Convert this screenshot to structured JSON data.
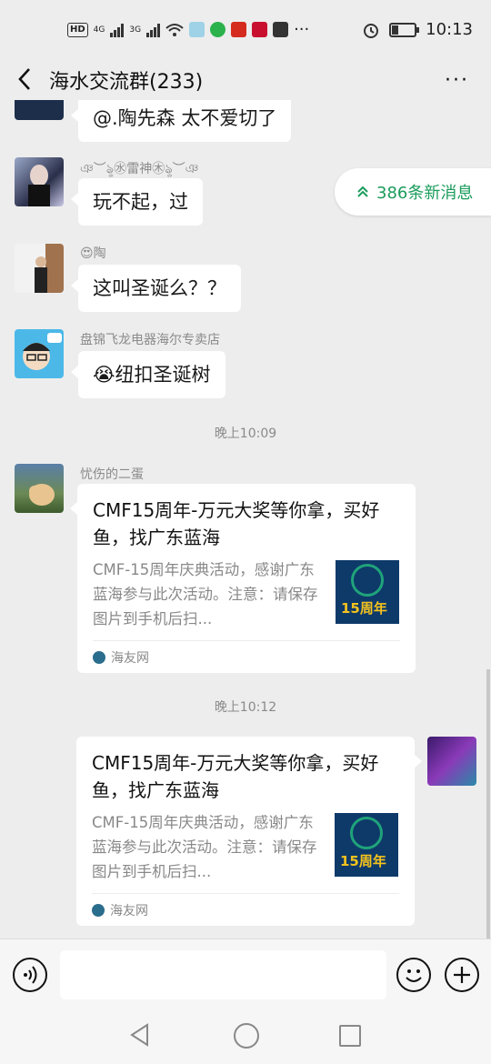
{
  "status_bar": {
    "time": "10:13",
    "net_hd": "HD",
    "net_1": "4G",
    "net_2": "3G",
    "more": "···"
  },
  "header": {
    "title": "海水交流群(233)",
    "more_label": "···"
  },
  "new_messages": {
    "label": "386条新消息"
  },
  "messages": [
    {
      "text": "@.陶先森  太不爱切了"
    },
    {
      "sender": "ঞ︶ৡ㊌雷神㊍ৡ︶ঞ",
      "text": "玩不起，过"
    },
    {
      "sender": "😍陶",
      "text": "这叫圣诞么？？"
    },
    {
      "sender": "盘锦飞龙电器海尔专卖店",
      "text": "😭纽扣圣诞树"
    }
  ],
  "times": [
    "晚上10:09",
    "晚上10:12"
  ],
  "cards": [
    {
      "sender": "忧伤的二蛋",
      "title": "CMF15周年-万元大奖等你拿，买好鱼，找广东蓝海",
      "desc": "CMF-15周年庆典活动，感谢广东蓝海参与此次活动。注意：请保存图片到手机后扫...",
      "thumb_text": "15周年",
      "source": "海友网"
    },
    {
      "title": "CMF15周年-万元大奖等你拿，买好鱼，找广东蓝海",
      "desc": "CMF-15周年庆典活动，感谢广东蓝海参与此次活动。注意：请保存图片到手机后扫...",
      "thumb_text": "15周年",
      "source": "海友网"
    }
  ],
  "colors": {
    "background": "#ededed",
    "accent_green": "#1a9c5b",
    "bubble": "#ffffff"
  }
}
